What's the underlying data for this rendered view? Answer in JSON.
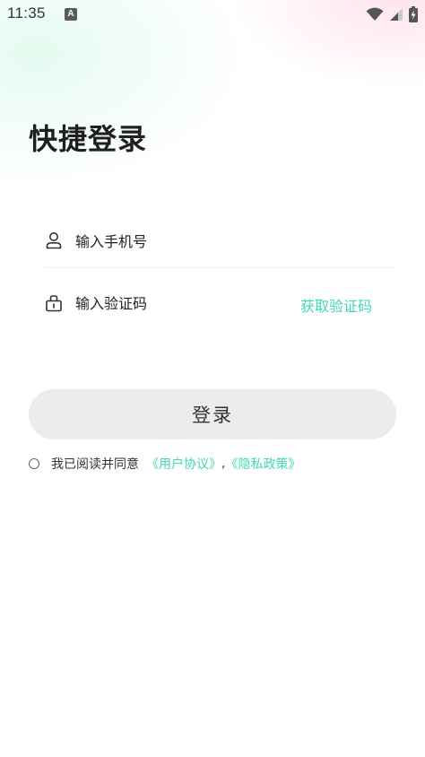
{
  "status_bar": {
    "time": "11:35",
    "notification_icon": "a-letter-notification-icon",
    "wifi_icon": "wifi-icon",
    "signal_icon": "signal-icon",
    "battery_icon": "battery-charging-icon"
  },
  "page": {
    "title": "快捷登录"
  },
  "form": {
    "phone_placeholder": "输入手机号",
    "code_placeholder": "输入验证码",
    "get_code_label": "获取验证码",
    "phone_icon": "user-icon",
    "code_icon": "lock-icon"
  },
  "login_button": {
    "label": "登录"
  },
  "agreement": {
    "prefix": "我已阅读并同意",
    "user_agreement": "《用户协议》",
    "separator": ",",
    "privacy_policy": "《隐私政策》"
  },
  "colors": {
    "accent": "#3fd9b2",
    "button_bg": "#ececec",
    "title": "#1f1f1f"
  }
}
